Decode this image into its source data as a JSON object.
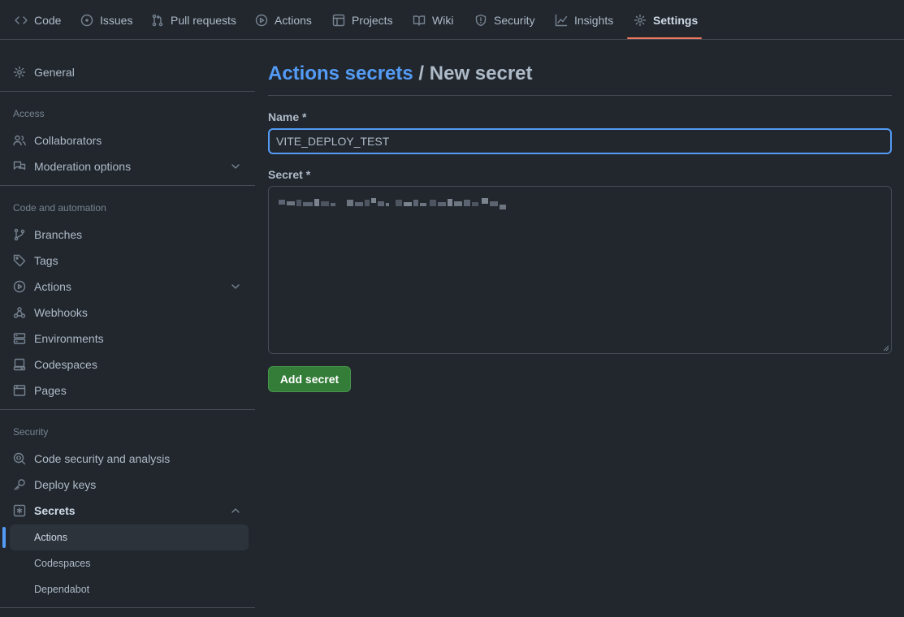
{
  "topnav": {
    "tabs": [
      {
        "label": "Code",
        "icon": "code-icon"
      },
      {
        "label": "Issues",
        "icon": "issue-opened-icon"
      },
      {
        "label": "Pull requests",
        "icon": "git-pull-request-icon"
      },
      {
        "label": "Actions",
        "icon": "play-icon"
      },
      {
        "label": "Projects",
        "icon": "table-icon"
      },
      {
        "label": "Wiki",
        "icon": "book-icon"
      },
      {
        "label": "Security",
        "icon": "shield-icon"
      },
      {
        "label": "Insights",
        "icon": "graph-icon"
      },
      {
        "label": "Settings",
        "icon": "gear-icon",
        "selected": true
      }
    ],
    "accent": "#ec775c"
  },
  "sidebar": {
    "general": "General",
    "access_label": "Access",
    "collaborators": "Collaborators",
    "moderation": "Moderation options",
    "code_automation_label": "Code and automation",
    "branches": "Branches",
    "tags": "Tags",
    "actions": "Actions",
    "webhooks": "Webhooks",
    "environments": "Environments",
    "codespaces": "Codespaces",
    "pages": "Pages",
    "security_label": "Security",
    "code_security": "Code security and analysis",
    "deploy_keys": "Deploy keys",
    "secrets": "Secrets",
    "secrets_sub": {
      "actions": "Actions",
      "codespaces": "Codespaces",
      "dependabot": "Dependabot"
    },
    "active_color": "#539bf5"
  },
  "main": {
    "breadcrumb_link": "Actions secrets",
    "breadcrumb_sep": " / ",
    "breadcrumb_current": "New secret",
    "name_label": "Name *",
    "name_value": "VITE_DEPLOY_TEST",
    "secret_label": "Secret *",
    "add_button": "Add secret",
    "button_color": "#347d39"
  }
}
